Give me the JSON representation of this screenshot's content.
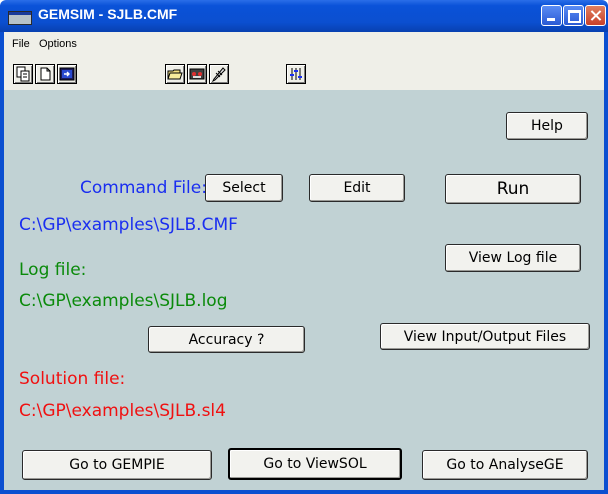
{
  "window": {
    "title": "GEMSIM - SJLB.CMF"
  },
  "menu": {
    "file": "File",
    "options": "Options"
  },
  "toolbar": {
    "icons": [
      "copy-icon",
      "new-file-icon",
      "exit-icon",
      "open-folder-icon",
      "tape-icon",
      "edit-pencil-icon",
      "settings-sliders-icon"
    ]
  },
  "buttons": {
    "help": "Help",
    "select": "Select",
    "edit": "Edit",
    "run": "Run",
    "view_log": "View Log file",
    "accuracy": "Accuracy ?",
    "view_io": "View Input/Output Files",
    "gempie": "Go to GEMPIE",
    "viewsol": "Go to ViewSOL",
    "analysege": "Go to AnalyseGE"
  },
  "labels": {
    "command_file": "Command File:",
    "command_path": "C:\\GP\\examples\\SJLB.CMF",
    "log_file": "Log file:",
    "log_path": "C:\\GP\\examples\\SJLB.log",
    "solution_file": "Solution file:",
    "solution_path": "C:\\GP\\examples\\SJLB.sl4"
  },
  "colors": {
    "command": "#1a2ef0",
    "log": "#0a8a0a",
    "solution": "#f01010",
    "client_bg": "#c1d2d4"
  }
}
